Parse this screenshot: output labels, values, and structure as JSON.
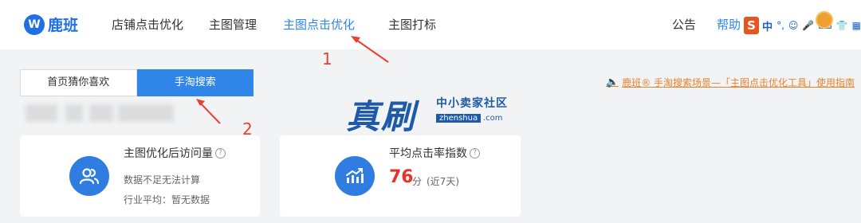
{
  "brand": {
    "logo_letter": "W",
    "name": "鹿班"
  },
  "nav": {
    "items": [
      {
        "label": "店铺点击优化",
        "active": false
      },
      {
        "label": "主图管理",
        "active": false
      },
      {
        "label": "主图点击优化",
        "active": true
      },
      {
        "label": "主图打标",
        "active": false
      }
    ],
    "announcement": "公告",
    "help": "帮助"
  },
  "ime": {
    "logo": "S",
    "mode": "中",
    "icons": [
      "°,",
      "☺",
      "🎤",
      "⌨",
      "👕",
      "▦"
    ]
  },
  "segments": [
    {
      "label": "首页猜你喜欢",
      "selected": false
    },
    {
      "label": "手淘搜索",
      "selected": true
    }
  ],
  "guide_link": "鹿班® 手淘搜索场景—「主图点击优化工具」使用指南",
  "watermark": {
    "main": "真刷",
    "tagline": "中小卖家社区",
    "url_a": "zhenshua",
    "url_b": ".com"
  },
  "cards": [
    {
      "title": "主图优化后访问量",
      "status": "数据不足无法计算",
      "industry_avg": "行业平均：暂无数据",
      "icon": "users-icon"
    },
    {
      "title": "平均点击率指数",
      "value": "76",
      "unit": "分",
      "period": "(近7天)",
      "icon": "trend-chart-icon"
    }
  ],
  "annotations": {
    "one": "1",
    "two": "2"
  },
  "colors": {
    "brand": "#1f6fe5",
    "accent": "#2f86e8",
    "highlight": "#e8312a",
    "annotation": "#e8412f",
    "guide": "#e8832d"
  }
}
